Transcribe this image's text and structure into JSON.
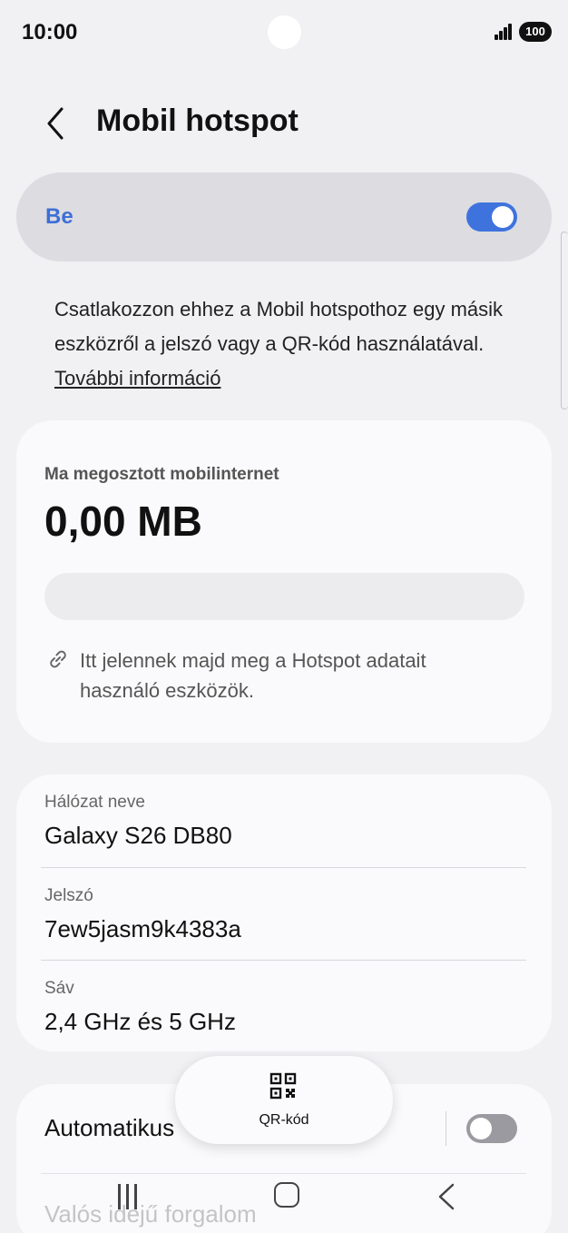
{
  "status_bar": {
    "time": "10:00",
    "battery": "100"
  },
  "header": {
    "title": "Mobil hotspot"
  },
  "toggle": {
    "label": "Be",
    "state": "on"
  },
  "description": {
    "text": "Csatlakozzon ehhez a Mobil hotspothoz egy másik eszközről a jelszó vagy a QR-kód használatával.",
    "link": "További információ"
  },
  "usage": {
    "label": "Ma megosztott mobilinternet",
    "value": "0,00 MB",
    "devices_note": "Itt jelennek majd meg a Hotspot adatait használó eszközök."
  },
  "network": {
    "name_label": "Hálózat neve",
    "name_value": "Galaxy S26 DB80",
    "password_label": "Jelszó",
    "password_value": "7ew5jasm9k4383a",
    "band_label": "Sáv",
    "band_value": "2,4 GHz és 5 GHz"
  },
  "auto": {
    "label": "Automatikus",
    "state": "off"
  },
  "realtime": {
    "label": "Valós idejű forgalom"
  },
  "qr_button": {
    "label": "QR-kód"
  },
  "colors": {
    "accent": "#3e73de",
    "background": "#f1f1f4",
    "card": "#fafafc"
  }
}
